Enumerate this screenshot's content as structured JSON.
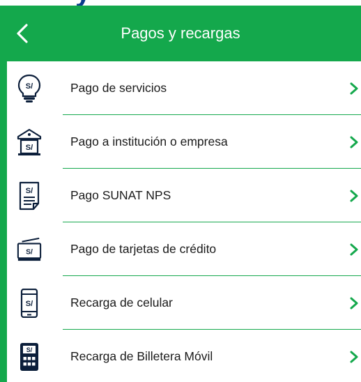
{
  "header": {
    "title": "Pagos y recargas",
    "peek_text": "y",
    "color": "#14a84c"
  },
  "menu": {
    "items": [
      {
        "label": "Pago de servicios",
        "icon": "bulb-icon"
      },
      {
        "label": "Pago a institución o empresa",
        "icon": "institution-icon"
      },
      {
        "label": "Pago SUNAT NPS",
        "icon": "document-icon"
      },
      {
        "label": "Pago de tarjetas de crédito",
        "icon": "credit-card-icon"
      },
      {
        "label": "Recarga de celular",
        "icon": "phone-icon"
      },
      {
        "label": "Recarga de Billetera Móvil",
        "icon": "wallet-calculator-icon"
      }
    ],
    "icon_text": "S/",
    "accent": "#14a84c"
  }
}
